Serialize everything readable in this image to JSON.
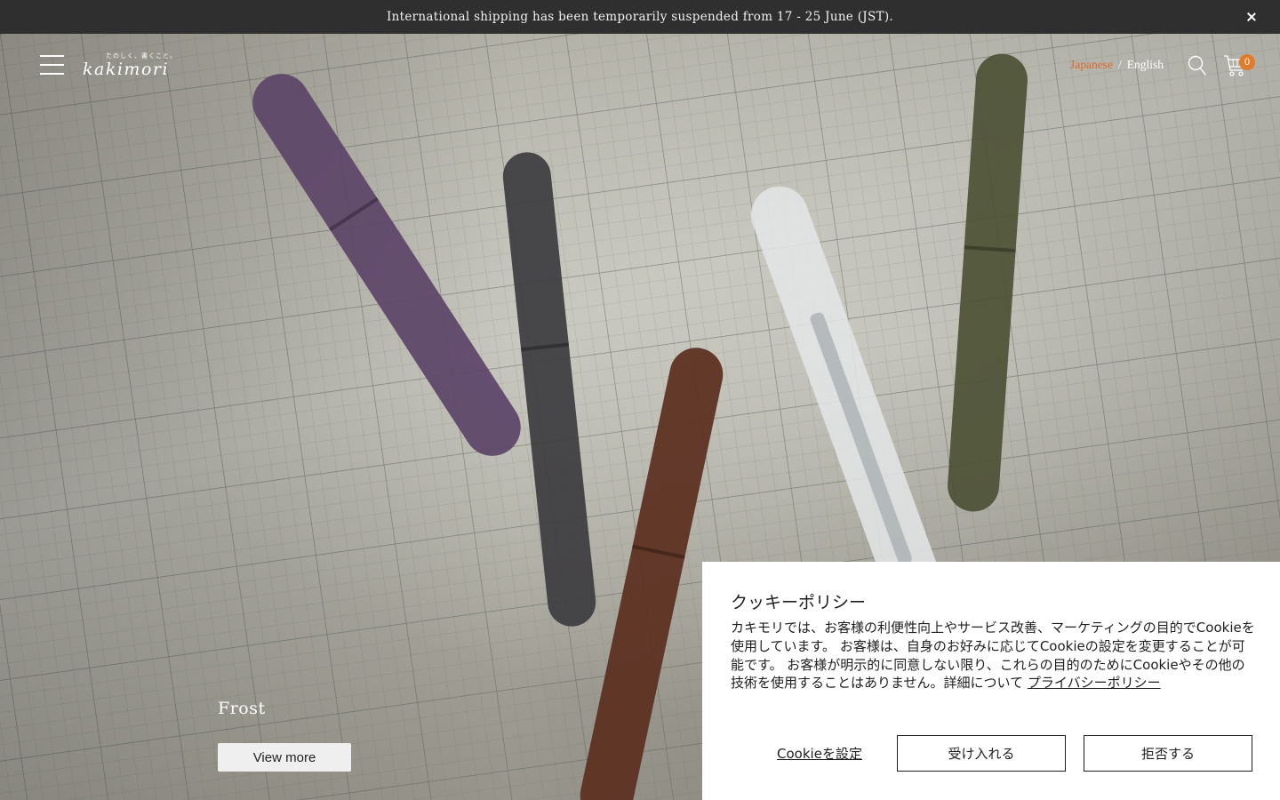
{
  "announcement": {
    "text": "International shipping has been temporarily suspended from 17 - 25 June (JST)."
  },
  "header": {
    "logo_tagline": "たのしく、書くこと。",
    "logo_name": "kakimori",
    "language": {
      "active": "Japanese",
      "separator": "/",
      "other": "English"
    },
    "cart_count": "0"
  },
  "hero": {
    "slide_title": "Frost",
    "button_label": "View more",
    "pen_colors": [
      "#5c4468",
      "#3d3c3f",
      "#5b2f1f",
      "#e4e6e7",
      "#4e5236"
    ]
  },
  "cookie_banner": {
    "title": "クッキーポリシー",
    "body": "カキモリでは、お客様の利便性向上やサービス改善、マーケティングの目的でCookieを使用しています。 お客様は、自身のお好みに応じてCookieの設定を変更することが可能です。 お客様が明示的に同意しない限り、これらの目的のためにCookieやその他の技術を使用することはありません。詳細について",
    "policy_link": "プライバシーポリシー",
    "settings_label": "Cookieを設定",
    "accept_label": "受け入れる",
    "reject_label": "拒否する"
  }
}
